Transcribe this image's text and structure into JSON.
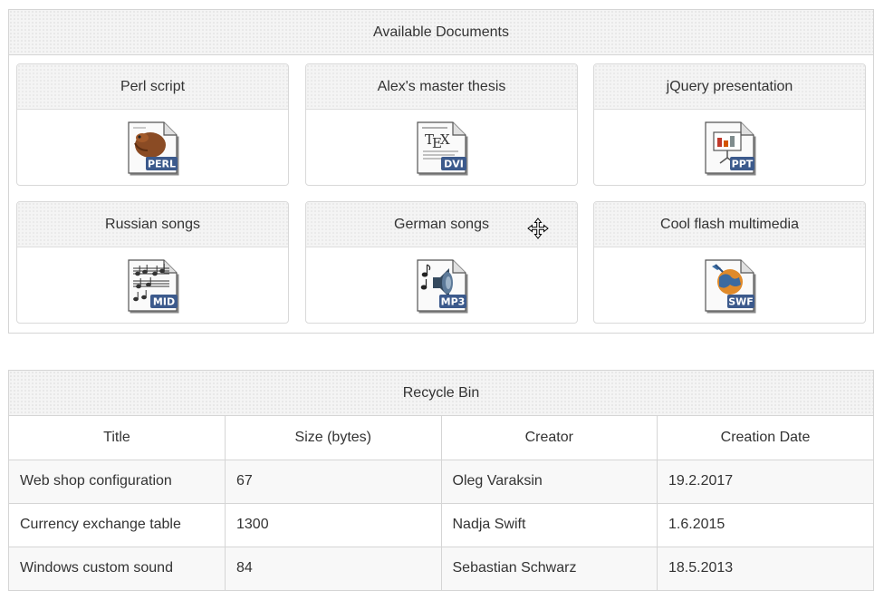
{
  "documents_panel": {
    "title": "Available Documents",
    "items": [
      {
        "title": "Perl script",
        "file_type": "PERL",
        "icon": "perl-file-icon"
      },
      {
        "title": "Alex's master thesis",
        "file_type": "DVI",
        "icon": "tex-dvi-file-icon"
      },
      {
        "title": "jQuery presentation",
        "file_type": "PPT",
        "icon": "ppt-file-icon"
      },
      {
        "title": "Russian songs",
        "file_type": "MID",
        "icon": "midi-file-icon"
      },
      {
        "title": "German songs",
        "file_type": "MP3",
        "icon": "mp3-file-icon"
      },
      {
        "title": "Cool flash multimedia",
        "file_type": "SWF",
        "icon": "swf-file-icon"
      }
    ]
  },
  "recycle_bin": {
    "title": "Recycle Bin",
    "columns": [
      "Title",
      "Size (bytes)",
      "Creator",
      "Creation Date"
    ],
    "rows": [
      [
        "Web shop configuration",
        "67",
        "Oleg Varaksin",
        "19.2.2017"
      ],
      [
        "Currency exchange table",
        "1300",
        "Nadja Swift",
        "1.6.2015"
      ],
      [
        "Windows custom sound",
        "84",
        "Sebastian Schwarz",
        "18.5.2013"
      ]
    ]
  },
  "colors": {
    "border": "#d5d5d5",
    "header_bg": "#f4f4f4",
    "text": "#333333",
    "badge_bg": "#3c5a8c"
  }
}
